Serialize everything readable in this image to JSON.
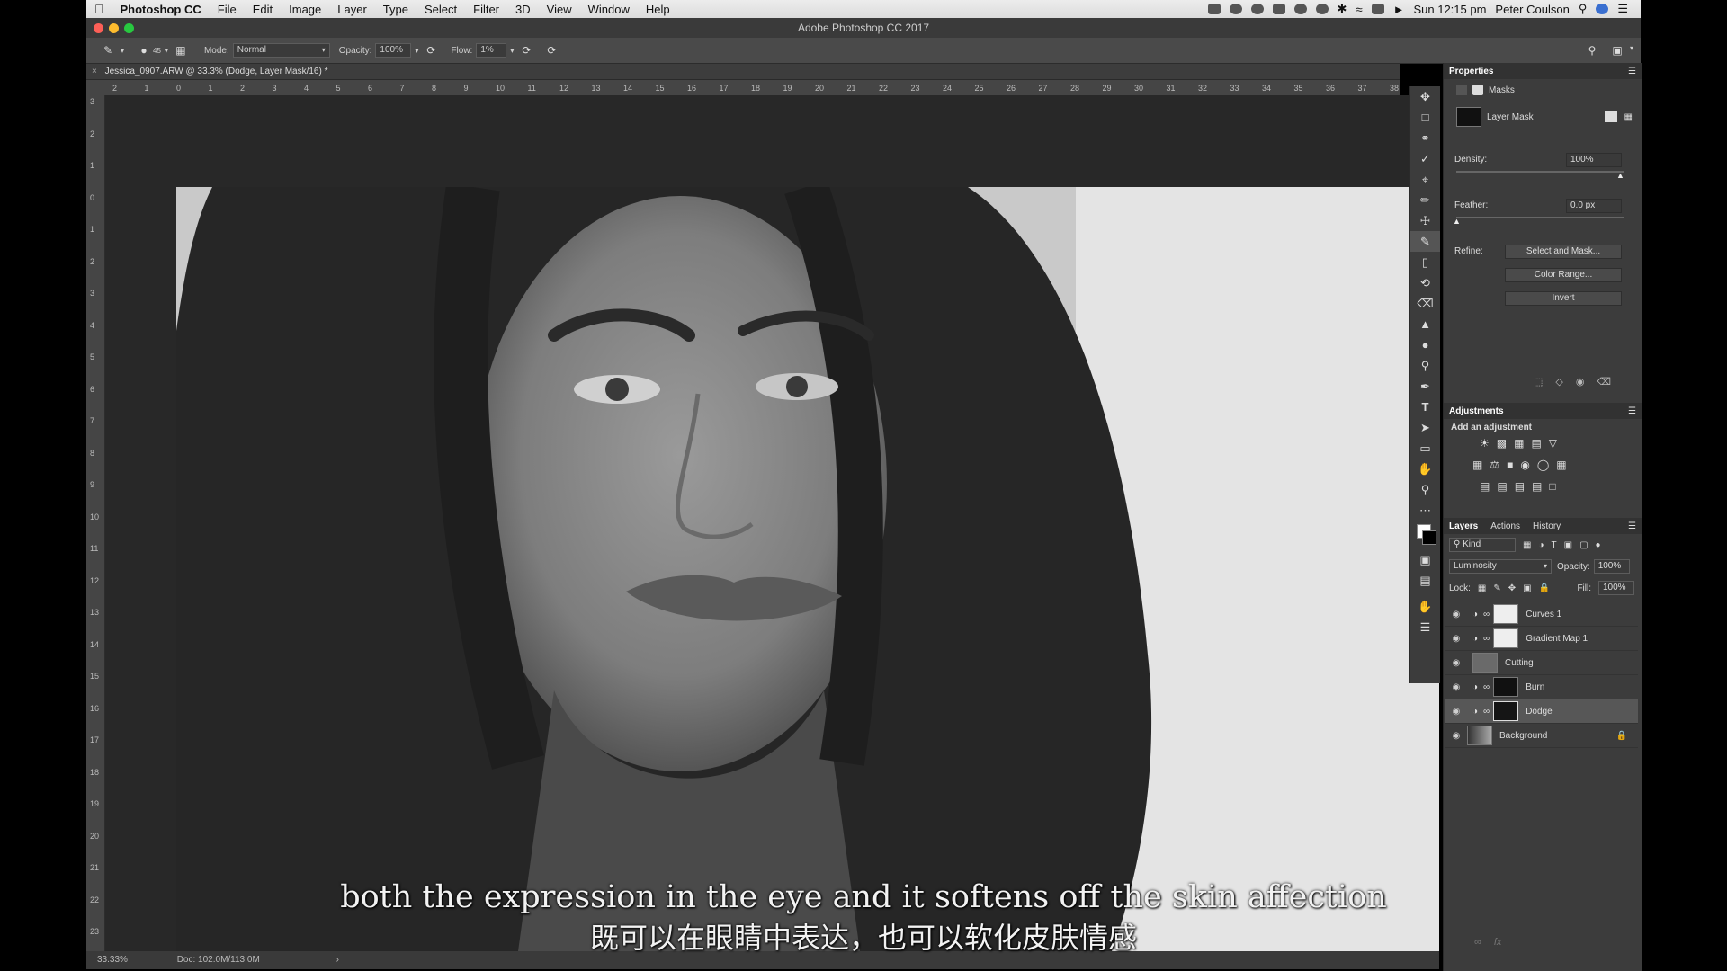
{
  "menubar": {
    "apple_icon": "apple-icon",
    "app": "Photoshop CC",
    "items": [
      "File",
      "Edit",
      "Image",
      "Layer",
      "Type",
      "Select",
      "Filter",
      "3D",
      "View",
      "Window",
      "Help"
    ],
    "clock": "Sun 12:15 pm",
    "user": "Peter Coulson"
  },
  "window": {
    "title": "Adobe Photoshop CC 2017"
  },
  "options": {
    "brush_size": "45",
    "mode_label": "Mode:",
    "mode_value": "Normal",
    "opacity_label": "Opacity:",
    "opacity_value": "100%",
    "flow_label": "Flow:",
    "flow_value": "1%"
  },
  "document": {
    "tab": "Jessica_0907.ARW @ 33.3% (Dodge, Layer Mask/16) *"
  },
  "rulers": {
    "h": [
      "2",
      "1",
      "0",
      "1",
      "2",
      "3",
      "4",
      "5",
      "6",
      "7",
      "8",
      "9",
      "10",
      "11",
      "12",
      "13",
      "14",
      "15",
      "16",
      "17",
      "18",
      "19",
      "20",
      "21",
      "22",
      "23",
      "24",
      "25",
      "26",
      "27",
      "28",
      "29",
      "30",
      "31",
      "32",
      "33",
      "34",
      "35",
      "36",
      "37",
      "38"
    ],
    "v": [
      "3",
      "2",
      "1",
      "0",
      "1",
      "2",
      "3",
      "4",
      "5",
      "6",
      "7",
      "8",
      "9",
      "10",
      "11",
      "12",
      "13",
      "14",
      "15",
      "16",
      "17",
      "18",
      "19",
      "20",
      "21",
      "22",
      "23"
    ]
  },
  "status": {
    "zoom": "33.33%",
    "doc": "Doc: 102.0M/113.0M"
  },
  "properties": {
    "tab": "Properties",
    "section": "Masks",
    "mask_label": "Layer Mask",
    "density_label": "Density:",
    "density_value": "100%",
    "feather_label": "Feather:",
    "feather_value": "0.0 px",
    "refine_label": "Refine:",
    "buttons": [
      "Select and Mask...",
      "Color Range...",
      "Invert"
    ]
  },
  "adjustments": {
    "tab": "Adjustments",
    "subtitle": "Add an adjustment"
  },
  "layers": {
    "tabs": [
      "Layers",
      "Actions",
      "History"
    ],
    "kind": "Kind",
    "blend": "Luminosity",
    "opacity_label": "Opacity:",
    "opacity_value": "100%",
    "lock_label": "Lock:",
    "fill_label": "Fill:",
    "fill_value": "100%",
    "items": [
      {
        "name": "Curves 1",
        "thumb": "#eeeeee"
      },
      {
        "name": "Gradient Map 1",
        "thumb": "#eeeeee"
      },
      {
        "name": "Cutting",
        "thumb": "#6a6a6a"
      },
      {
        "name": "Burn",
        "thumb": "#111111"
      },
      {
        "name": "Dodge",
        "thumb": "#151515"
      },
      {
        "name": "Background",
        "thumb": "#777777"
      }
    ],
    "selected": "Dodge"
  },
  "subtitles": {
    "en": "both the expression in the eye and it softens off the skin affection",
    "zh": "既可以在眼睛中表达，也可以软化皮肤情感"
  },
  "colors": {
    "panel": "#3c3c3c",
    "selected_layer": "#575757",
    "menubar": "#e4e4e4"
  }
}
